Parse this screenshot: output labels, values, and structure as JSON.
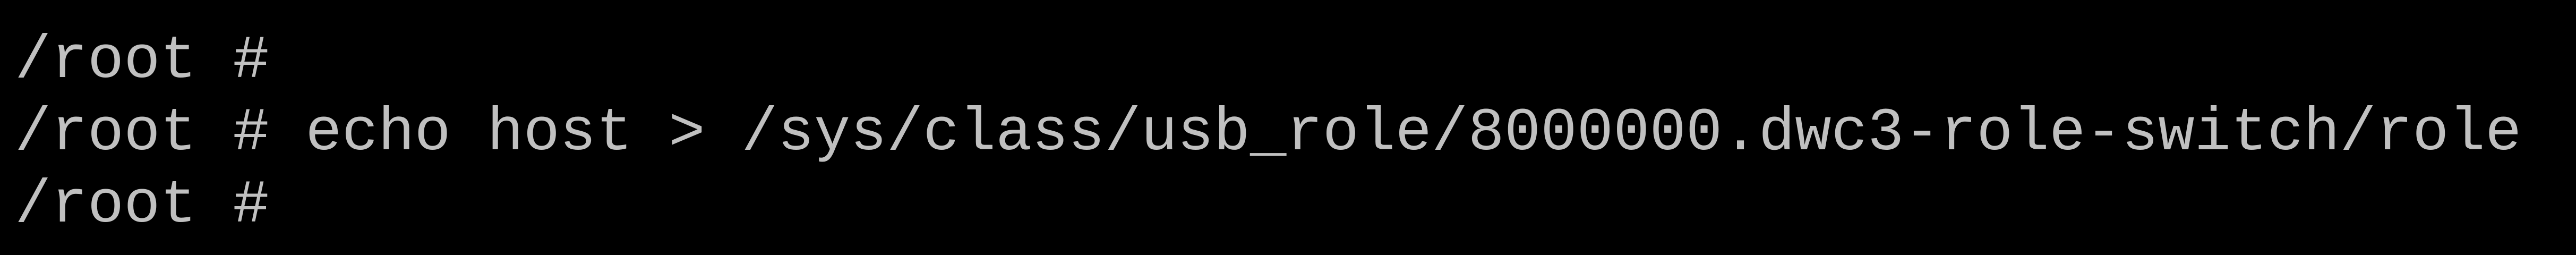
{
  "terminal": {
    "foreground": "#c0c0c0",
    "background": "#000000",
    "lines": [
      "/root #",
      "/root #",
      "/root # echo host > /sys/class/usb_role/8000000.dwc3-role-switch/role",
      "/root #"
    ]
  }
}
